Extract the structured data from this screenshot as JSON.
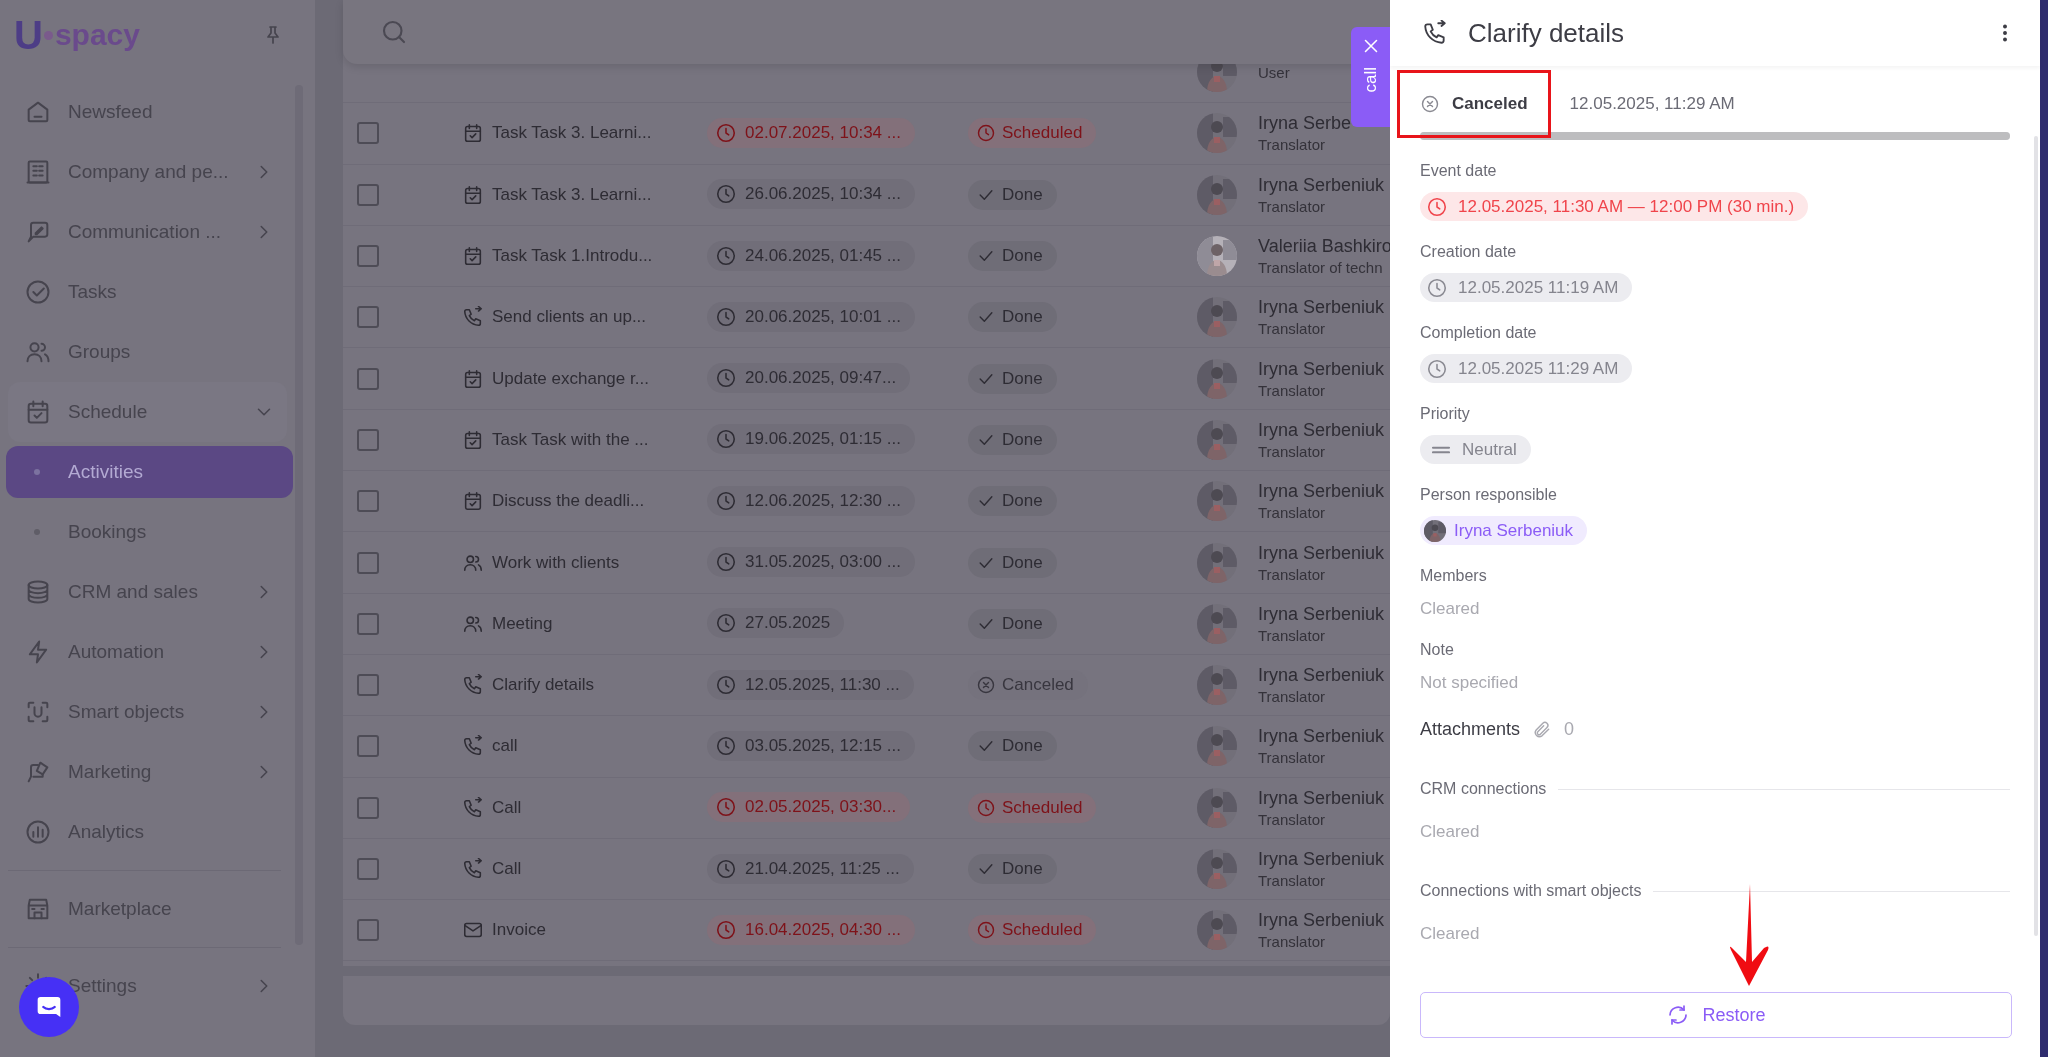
{
  "sidebar": {
    "logo_mark": "U",
    "logo_text": "spacy",
    "groups": [
      [
        {
          "label": "Newsfeed",
          "selected": false
        },
        {
          "label": "Company and pe...",
          "selected": false,
          "expanded": false
        },
        {
          "label": "Communication ...",
          "selected": false,
          "expanded": false
        },
        {
          "label": "Tasks",
          "selected": false
        },
        {
          "label": "Groups",
          "selected": false
        },
        {
          "label": "Schedule",
          "selected": false,
          "expanded": true,
          "children": [
            {
              "label": "Activities",
              "selected": true
            },
            {
              "label": "Bookings",
              "selected": false
            }
          ]
        },
        {
          "label": "CRM and sales",
          "selected": false,
          "expanded": false
        },
        {
          "label": "Automation",
          "selected": false,
          "expanded": false
        },
        {
          "label": "Smart objects",
          "selected": false,
          "expanded": false
        },
        {
          "label": "Marketing",
          "selected": false,
          "expanded": false
        },
        {
          "label": "Analytics",
          "selected": false
        }
      ],
      [
        {
          "label": "Marketplace",
          "selected": false
        }
      ],
      [
        {
          "label": "Settings",
          "selected": false,
          "expanded": false
        }
      ]
    ]
  },
  "table": {
    "rows": [
      {
        "role": "User"
      },
      {
        "checked": false,
        "kind": "task",
        "title": "Task Task 3. Learni...",
        "date": "02.07.2025, 10:34 ...",
        "overdue": true,
        "status": {
          "kind": "scheduled",
          "label": "Scheduled"
        },
        "person": "Iryna Serbe",
        "role": "Translator"
      },
      {
        "checked": false,
        "kind": "task",
        "title": "Task Task 3. Learni...",
        "date": "26.06.2025, 10:34 ...",
        "overdue": false,
        "status": {
          "kind": "done",
          "label": "Done"
        },
        "person": "Iryna Serbeniuk",
        "role": "Translator"
      },
      {
        "checked": false,
        "kind": "task",
        "title": "Task Task 1.Introdu...",
        "date": "24.06.2025, 01:45 ...",
        "overdue": false,
        "status": {
          "kind": "done",
          "label": "Done"
        },
        "person": "Valeriia Bashkiro",
        "role": "Translator of techn"
      },
      {
        "checked": false,
        "kind": "call",
        "title": "Send clients an up...",
        "date": "20.06.2025, 10:01 ...",
        "overdue": false,
        "status": {
          "kind": "done",
          "label": "Done"
        },
        "person": "Iryna Serbeniuk",
        "role": "Translator"
      },
      {
        "checked": false,
        "kind": "task",
        "title": "Update exchange r...",
        "date": "20.06.2025, 09:47...",
        "overdue": false,
        "status": {
          "kind": "done",
          "label": "Done"
        },
        "person": "Iryna Serbeniuk",
        "role": "Translator"
      },
      {
        "checked": false,
        "kind": "task",
        "title": "Task Task with the ...",
        "date": "19.06.2025, 01:15 ...",
        "overdue": false,
        "status": {
          "kind": "done",
          "label": "Done"
        },
        "person": "Iryna Serbeniuk",
        "role": "Translator"
      },
      {
        "checked": false,
        "kind": "task",
        "title": "Discuss the deadli...",
        "date": "12.06.2025, 12:30 ...",
        "overdue": false,
        "status": {
          "kind": "done",
          "label": "Done"
        },
        "person": "Iryna Serbeniuk",
        "role": "Translator"
      },
      {
        "checked": false,
        "kind": "meeting",
        "title": "Work with clients",
        "date": "31.05.2025, 03:00 ...",
        "overdue": false,
        "status": {
          "kind": "done",
          "label": "Done"
        },
        "person": "Iryna Serbeniuk",
        "role": "Translator"
      },
      {
        "checked": false,
        "kind": "meeting",
        "title": "Meeting",
        "date": "27.05.2025",
        "overdue": false,
        "status": {
          "kind": "done",
          "label": "Done"
        },
        "person": "Iryna Serbeniuk",
        "role": "Translator"
      },
      {
        "checked": false,
        "kind": "call",
        "title": "Clarify details",
        "date": "12.05.2025, 11:30 ...",
        "overdue": false,
        "status": {
          "kind": "canceled",
          "label": "Canceled"
        },
        "person": "Iryna Serbeniuk",
        "role": "Translator"
      },
      {
        "checked": false,
        "kind": "call",
        "title": "call",
        "date": "03.05.2025, 12:15 ...",
        "overdue": false,
        "status": {
          "kind": "done",
          "label": "Done"
        },
        "person": "Iryna Serbeniuk",
        "role": "Translator"
      },
      {
        "checked": false,
        "kind": "call",
        "title": "Call",
        "date": "02.05.2025, 03:30...",
        "overdue": true,
        "status": {
          "kind": "scheduled",
          "label": "Scheduled"
        },
        "person": "Iryna Serbeniuk",
        "role": "Translator"
      },
      {
        "checked": false,
        "kind": "call",
        "title": "Call",
        "date": "21.04.2025, 11:25 ...",
        "overdue": false,
        "status": {
          "kind": "done",
          "label": "Done"
        },
        "person": "Iryna Serbeniuk",
        "role": "Translator"
      },
      {
        "checked": false,
        "kind": "email",
        "title": "Invoice",
        "date": "16.04.2025, 04:30 ...",
        "overdue": true,
        "status": {
          "kind": "scheduled",
          "label": "Scheduled"
        },
        "person": "Iryna Serbeniuk",
        "role": "Translator"
      }
    ]
  },
  "call_tab": {
    "label": "call"
  },
  "panel": {
    "title": "Clarify details",
    "status": {
      "kind": "canceled",
      "label": "Canceled",
      "date": "12.05.2025, 11:29 AM",
      "level": 1
    },
    "fields": [
      {
        "kind": "chip",
        "label": "Event date",
        "value": "12.05.2025, 11:30 AM — 12:00 PM (30 min.)",
        "overdue": true
      },
      {
        "kind": "chip",
        "label": "Creation date",
        "value": "12.05.2025 11:19 AM",
        "overdue": false
      },
      {
        "kind": "chip",
        "label": "Completion date",
        "value": "12.05.2025 11:29 AM",
        "overdue": false
      },
      {
        "kind": "priority",
        "label": "Priority",
        "value": "Neutral"
      },
      {
        "kind": "person",
        "label": "Person responsible",
        "value": "Iryna Serbeniuk"
      },
      {
        "kind": "text",
        "label": "Members",
        "value": "Cleared"
      },
      {
        "kind": "text",
        "label": "Note",
        "value": "Not specified"
      },
      {
        "kind": "attachments",
        "label": "Attachments",
        "value": "0"
      },
      {
        "kind": "section",
        "label": "CRM connections",
        "value": "Cleared"
      },
      {
        "kind": "section",
        "label": "Connections with smart objects",
        "value": "Cleared"
      }
    ],
    "button": "Restore"
  }
}
